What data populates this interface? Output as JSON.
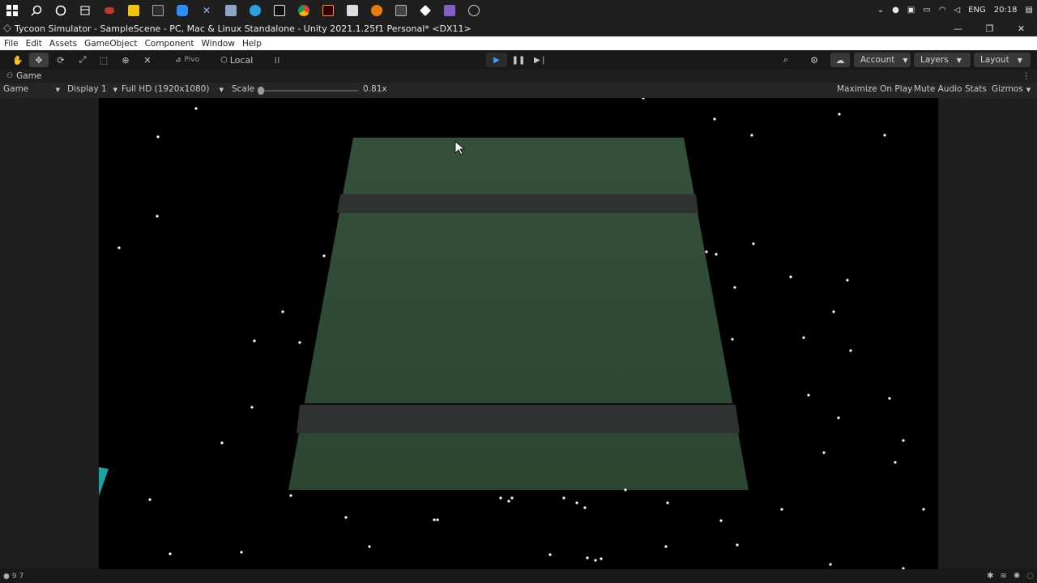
{
  "taskbar": {
    "icons": [
      "windows-icon",
      "search-icon",
      "cortana-icon",
      "task-view-icon",
      "app-icon",
      "file-explorer-icon",
      "terminal-icon",
      "zoom-icon",
      "app-icon",
      "notes-icon",
      "telegram-icon",
      "pycharm-icon",
      "chrome-icon",
      "illustrator-icon",
      "app-icon",
      "blender-icon",
      "app-icon",
      "unity-icon",
      "visual-studio-icon",
      "app-icon"
    ],
    "lang": "ENG",
    "time": "20:18"
  },
  "window": {
    "title": "Tycoon Simulator - SampleScene - PC, Mac & Linux Standalone - Unity 2021.1.25f1 Personal* <DX11>"
  },
  "menu": [
    "File",
    "Edit",
    "Assets",
    "GameObject",
    "Component",
    "Window",
    "Help"
  ],
  "toolbar": {
    "pivot_label": "Pivo",
    "local_label": "Local",
    "account_label": "Account",
    "layers_label": "Layers",
    "layout_label": "Layout"
  },
  "tab": {
    "label": "Game"
  },
  "gamebar": {
    "mode": "Game",
    "display": "Display 1",
    "resolution": "Full HD (1920x1080)",
    "scale_label": "Scale",
    "scale_value": "0.81x",
    "maximize": "Maximize On Play",
    "mute": "Mute Audio",
    "stats": "Stats",
    "gizmos": "Gizmos"
  },
  "statusbar": {
    "text": "9 7"
  },
  "colors": {
    "ground": "#2e4a33",
    "road": "#2f3231",
    "stars": "#ffffff"
  }
}
